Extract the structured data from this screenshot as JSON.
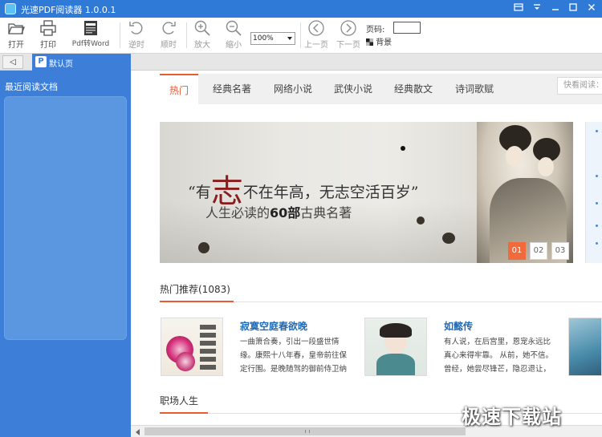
{
  "window": {
    "title": "光速PDF阅读器 1.0.0.1"
  },
  "toolbar": {
    "open": "打开",
    "print": "打印",
    "pdf_to_word": "Pdf转Word",
    "rotate_ccw": "逆时",
    "rotate_cw": "顺时",
    "zoom_in": "放大",
    "zoom_out": "缩小",
    "zoom_value": "100%",
    "prev_page": "上一页",
    "next_page": "下一页",
    "page_label": "页码:",
    "page_value": "",
    "background": "背景"
  },
  "tabs": {
    "back": "◁",
    "current_tab": "默认页"
  },
  "sidebar": {
    "heading": "最近阅读文档"
  },
  "categories": {
    "items": [
      "热门",
      "经典名著",
      "网络小说",
      "武侠小说",
      "经典散文",
      "诗词歌赋"
    ],
    "active_index": 0,
    "search_placeholder": "快看阅读："
  },
  "banner": {
    "quote_open": "“有",
    "quote_big": "志",
    "quote_rest": "不在年高，无志空活百岁”",
    "sub_pre": "人生必读的",
    "sub_bold": "60部",
    "sub_post": "古典名著",
    "slides": [
      "01",
      "02",
      "03"
    ],
    "active_slide": 0
  },
  "hot": {
    "title": "热门推荐(1083)",
    "books": [
      {
        "title": "寂寞空庭春欲晚",
        "desc": "一曲箫合奏，引出一段盛世情缘。康熙十八年春，皇帝前往保定行围。是晚随驾的御前侍卫纳兰容"
      },
      {
        "title": "如懿传",
        "desc": "有人说，在后宫里，恩宠永远比真心来得牢靠。 从前，她不信。 曾经，她尝尽锋芒，隐忍退让，只因"
      }
    ]
  },
  "career": {
    "title": "职场人生"
  },
  "watermark": "极速下载站",
  "colors": {
    "title_bar": "#2f7ad6",
    "sidebar": "#3d7fd8",
    "accent": "#e85a31",
    "link": "#1d6ab8"
  }
}
